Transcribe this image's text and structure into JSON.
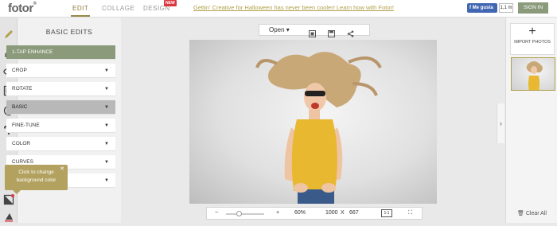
{
  "header": {
    "logo": "fotor",
    "logo_mark": "®",
    "tabs": [
      "EDIT",
      "COLLAGE",
      "DESIGN"
    ],
    "new_badge": "NEW",
    "promo": "Gettin' Creative for Halloween has never been cooler! Learn how with Fotor!",
    "fb_like": "Me gusta",
    "fb_count": "1,1 m",
    "sign_in": "SIGN IN"
  },
  "panel": {
    "title": "BASIC EDITS",
    "items": [
      "1-TAP ENHANCE",
      "CROP",
      "ROTATE",
      "BASIC",
      "FINE-TUNE",
      "COLOR",
      "CURVES",
      ""
    ]
  },
  "tooltip": {
    "line1": "Click to change",
    "line2": "background color"
  },
  "toolbar": {
    "open": "Open"
  },
  "zoom": {
    "percent": "60%",
    "level": 0.35,
    "width": "1000",
    "times": "X",
    "height": "667",
    "ratio": "1:1"
  },
  "right": {
    "import": "IMPORT PHOTOS",
    "clear": "Clear All"
  },
  "colors": {
    "accent": "#b1a04a",
    "enhance": "#8a9a7a",
    "selected": "#b8b8b8",
    "tooltip": "#b3a15f",
    "shirt": "#e8b830"
  }
}
